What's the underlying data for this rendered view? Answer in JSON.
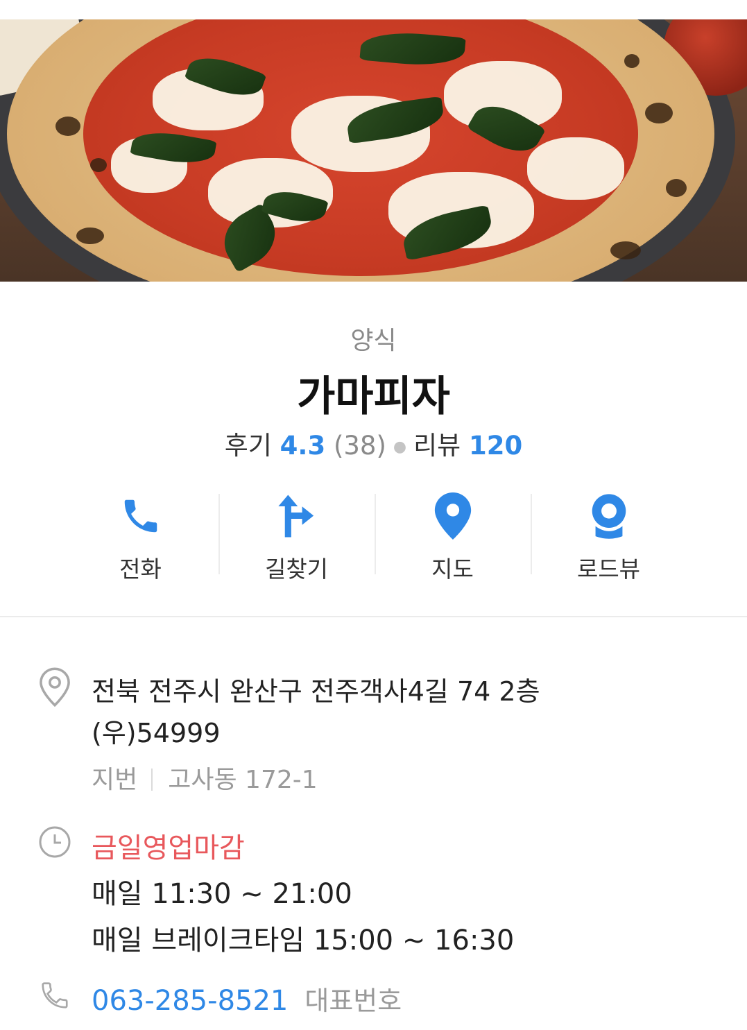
{
  "place": {
    "category": "양식",
    "name": "가마피자"
  },
  "ratings": {
    "review_label": "후기",
    "score": "4.3",
    "score_count": "(38)",
    "blog_label": "리뷰",
    "blog_count": "120"
  },
  "actions": [
    {
      "label": "전화",
      "icon": "phone-icon"
    },
    {
      "label": "길찾기",
      "icon": "directions-icon"
    },
    {
      "label": "지도",
      "icon": "map-pin-icon"
    },
    {
      "label": "로드뷰",
      "icon": "roadview-icon"
    }
  ],
  "address": {
    "line1": "전북 전주시 완산구 전주객사4길 74 2층",
    "postal": "(우)54999",
    "jibun_label": "지번",
    "jibun_value": "고사동 172-1"
  },
  "hours": {
    "status": "금일영업마감",
    "daily": "매일 11:30 ~ 21:00",
    "break": "매일 브레이크타임 15:00 ~ 16:30"
  },
  "contact": {
    "phone": "063-285-8521",
    "phone_type": "대표번호"
  },
  "colors": {
    "accent_blue": "#2f88e6",
    "closed_red": "#e8585c",
    "muted_grey": "#9a9a9a"
  }
}
